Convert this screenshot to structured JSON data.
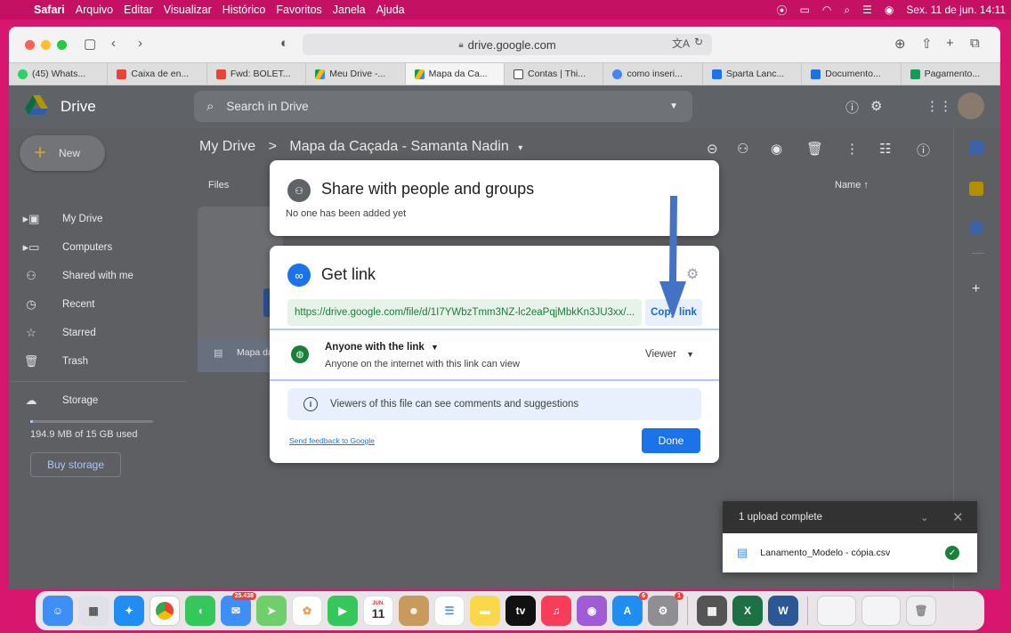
{
  "menubar": {
    "items": [
      "Safari",
      "Arquivo",
      "Editar",
      "Visualizar",
      "Histórico",
      "Favoritos",
      "Janela",
      "Ajuda"
    ],
    "clock": "Sex. 11 de jun.  14:11"
  },
  "browser": {
    "address": "drive.google.com",
    "tabs": [
      {
        "label": "(45) Whats...",
        "color": "#25d366"
      },
      {
        "label": "Caixa de en...",
        "color": "#ea4335"
      },
      {
        "label": "Fwd: BOLET...",
        "color": "#ea4335"
      },
      {
        "label": "Meu Drive -...",
        "color": "#fbbc04"
      },
      {
        "label": "Mapa da Ca...",
        "color": "#fbbc04"
      },
      {
        "label": "Contas | Thi...",
        "color": "#444444"
      },
      {
        "label": "como inseri...",
        "color": "#4285f4"
      },
      {
        "label": "Sparta Lanc...",
        "color": "#1a73e8"
      },
      {
        "label": "Documento...",
        "color": "#1a73e8"
      },
      {
        "label": "Pagamento...",
        "color": "#0f9d58"
      }
    ]
  },
  "drive": {
    "logo_text": "Drive",
    "search_placeholder": "Search in Drive",
    "new_label": "New",
    "breadcrumb_root": "My Drive",
    "breadcrumb_sep": ">",
    "breadcrumb_folder": "Mapa da Caçada - Samanta Nadin",
    "files_header": "Files",
    "name_header": "Name",
    "file_card_name": "Mapa da (",
    "nav": [
      {
        "label": "My Drive",
        "icon": "drive-icon"
      },
      {
        "label": "Computers",
        "icon": "computer-icon"
      },
      {
        "label": "Shared with me",
        "icon": "shared-icon"
      },
      {
        "label": "Recent",
        "icon": "clock-icon"
      },
      {
        "label": "Starred",
        "icon": "star-icon"
      },
      {
        "label": "Trash",
        "icon": "trash-icon"
      }
    ],
    "storage_label": "Storage",
    "storage_used": "194.9 MB of 15 GB used",
    "buy_storage": "Buy storage"
  },
  "share_dialog": {
    "title": "Share with people and groups",
    "subtitle": "No one has been added yet"
  },
  "link_dialog": {
    "title": "Get link",
    "url": "https://drive.google.com/file/d/1I7YWbzTmm3NZ-lc2eaPqjMbkKn3JU3xx/...",
    "copy_label": "Copy link",
    "access_title": "Anyone with the link",
    "access_sub": "Anyone on the internet with this link can view",
    "role": "Viewer",
    "info": "Viewers of this file can see comments and suggestions",
    "feedback": "Send feedback to Google",
    "done": "Done"
  },
  "upload_toast": {
    "title": "1 upload complete",
    "file": "Lanamento_Modelo - cópia.csv"
  },
  "dock": {
    "mail_badge": "25.438",
    "calendar_month": "JUN.",
    "calendar_day": "11",
    "tv_label": "tv",
    "appstore_badge": "6",
    "settings_badge": "1"
  }
}
